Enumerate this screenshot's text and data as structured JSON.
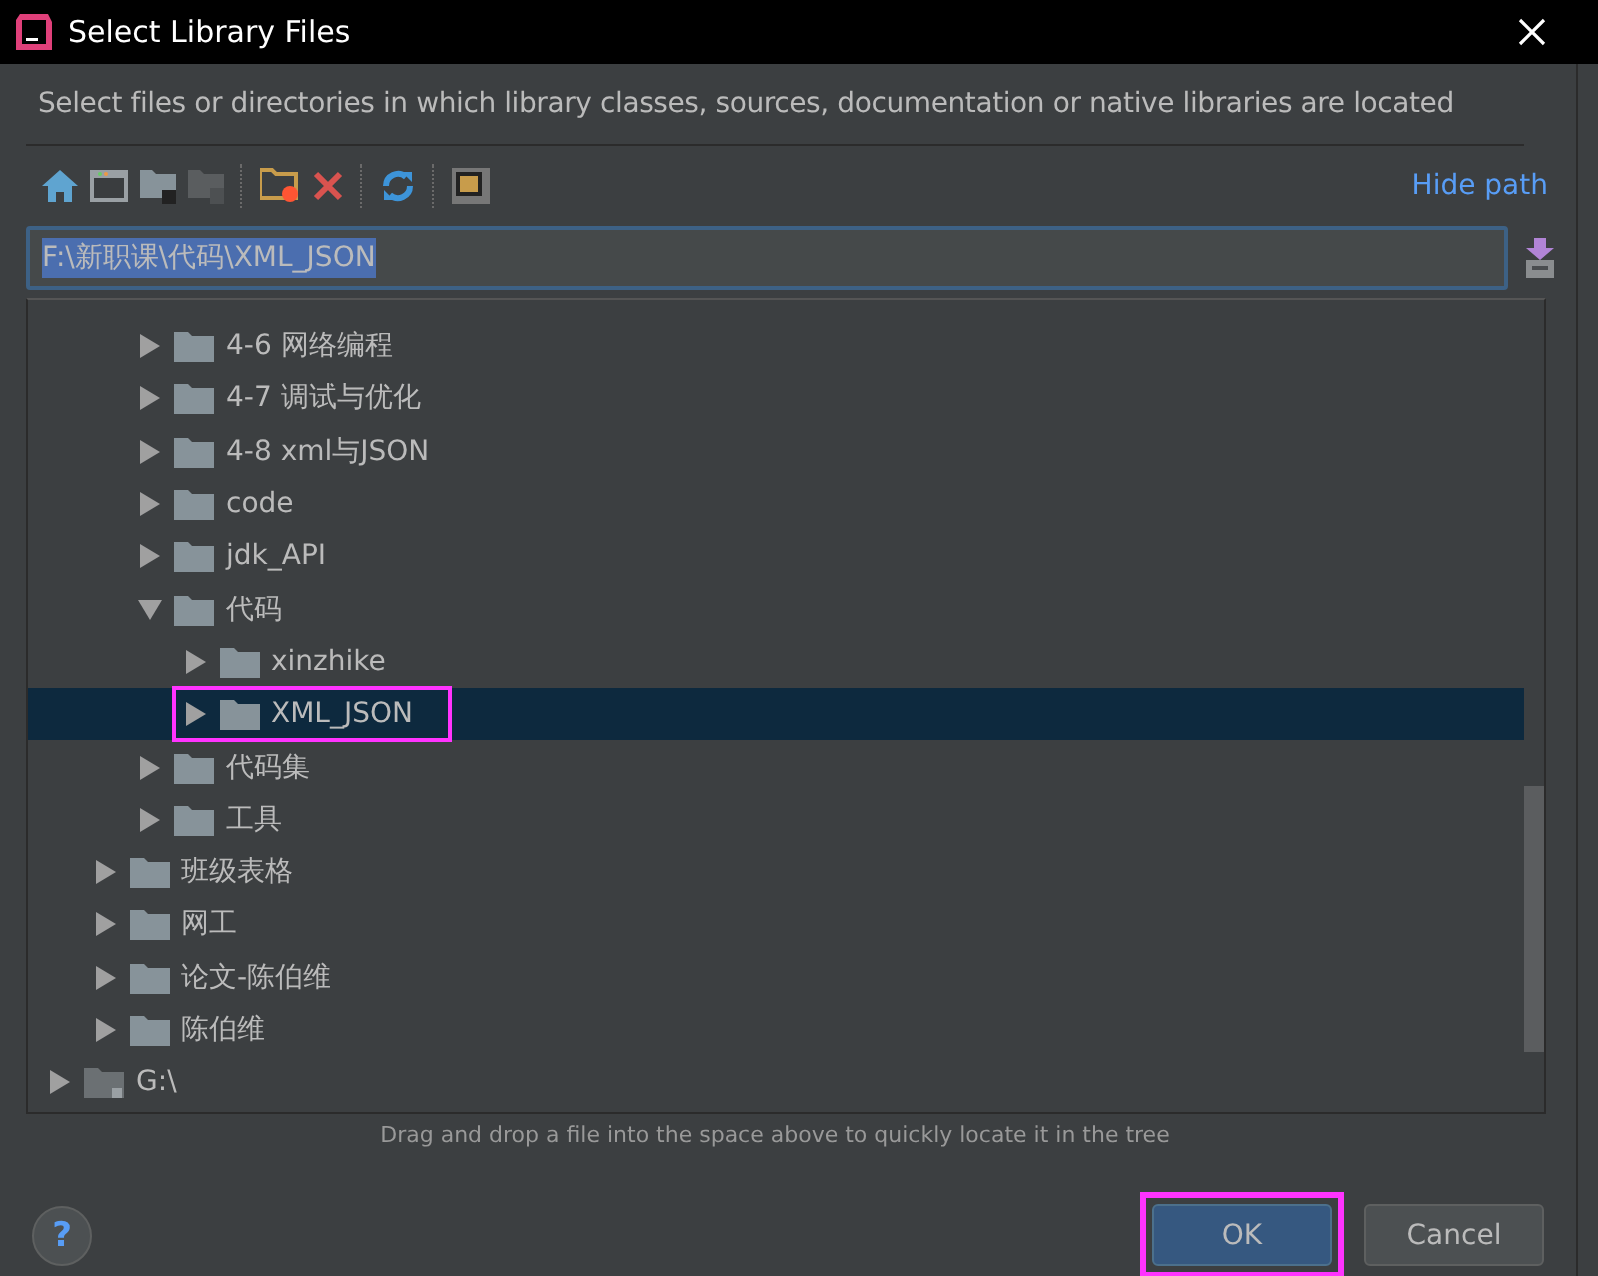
{
  "window": {
    "title": "Select Library Files"
  },
  "description": "Select files or directories in which library classes, sources, documentation or native libraries are located",
  "toolbar": {
    "hide_path": "Hide path"
  },
  "path_field": {
    "value": "F:\\新职课\\代码\\XML_JSON"
  },
  "tree": [
    {
      "children": [
        {
          "children": [
            {
              "label": "4-6 网络编程",
              "expanded": false,
              "selected": false
            },
            {
              "label": "4-7 调试与优化",
              "expanded": false,
              "selected": false
            },
            {
              "label": "4-8 xml与JSON",
              "expanded": false,
              "selected": false
            },
            {
              "label": "code",
              "expanded": false,
              "selected": false
            },
            {
              "label": "jdk_API",
              "expanded": false,
              "selected": false
            },
            {
              "label": "代码",
              "expanded": true,
              "selected": false,
              "children": [
                {
                  "label": "xinzhike",
                  "expanded": false,
                  "selected": false
                },
                {
                  "label": "XML_JSON",
                  "expanded": false,
                  "selected": true,
                  "annotated": true
                }
              ]
            },
            {
              "label": "代码集",
              "expanded": false,
              "selected": false
            },
            {
              "label": "工具",
              "expanded": false,
              "selected": false
            }
          ]
        },
        {
          "label": "班级表格",
          "expanded": false,
          "selected": false
        },
        {
          "label": "网工",
          "expanded": false,
          "selected": false
        },
        {
          "label": "论文-陈伯维",
          "expanded": false,
          "selected": false
        },
        {
          "label": "陈伯维",
          "expanded": false,
          "selected": false
        }
      ]
    },
    {
      "label": "G:\\",
      "expanded": false,
      "selected": false,
      "kind": "drive"
    }
  ],
  "help": {
    "label": "?"
  },
  "hint": "Drag and drop a file into the space above to quickly locate it in the tree",
  "buttons": [
    {
      "label": "OK",
      "primary": true,
      "annotated": true
    },
    {
      "label": "Cancel",
      "primary": false,
      "annotated": false
    }
  ]
}
